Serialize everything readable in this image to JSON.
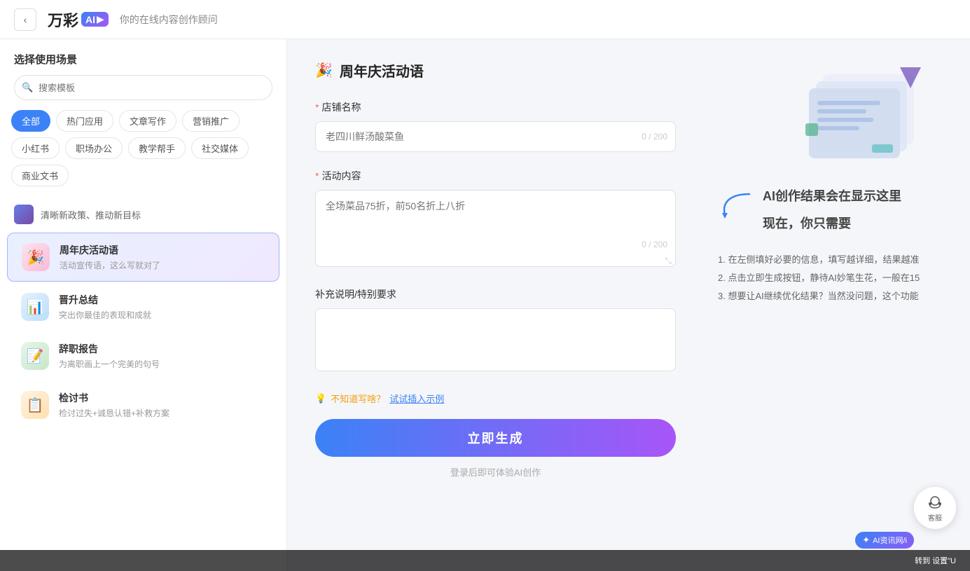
{
  "header": {
    "back_label": "‹",
    "logo_text": "万彩",
    "logo_ai": "AI",
    "subtitle": "你的在线内容创作顾问"
  },
  "sidebar": {
    "section_title": "选择使用场景",
    "search_placeholder": "搜索模板",
    "categories": [
      {
        "label": "全部",
        "active": true
      },
      {
        "label": "热门应用",
        "active": false
      },
      {
        "label": "文章写作",
        "active": false
      },
      {
        "label": "营销推广",
        "active": false
      },
      {
        "label": "小红书",
        "active": false
      },
      {
        "label": "职场办公",
        "active": false
      },
      {
        "label": "教学帮手",
        "active": false
      },
      {
        "label": "社交媒体",
        "active": false
      },
      {
        "label": "商业文书",
        "active": false
      }
    ],
    "special_item": {
      "text": "清晰新政策、推动新目标"
    },
    "items": [
      {
        "id": "anniversary",
        "title": "周年庆活动语",
        "desc": "活动宣传语，这么写就对了",
        "icon": "🎉",
        "icon_class": "item-icon-party",
        "selected": true
      },
      {
        "id": "promotion",
        "title": "晋升总结",
        "desc": "突出你最佳的表现和成就",
        "icon": "📊",
        "icon_class": "item-icon-chart",
        "selected": false
      },
      {
        "id": "resign",
        "title": "辞职报告",
        "desc": "为离职画上一个完美的句号",
        "icon": "📝",
        "icon_class": "item-icon-resign",
        "selected": false
      },
      {
        "id": "review",
        "title": "检讨书",
        "desc": "检讨过失+诚恳认错+补救方案",
        "icon": "📋",
        "icon_class": "item-icon-review",
        "selected": false
      }
    ]
  },
  "form": {
    "title": "周年庆活动语",
    "title_icon": "🎉",
    "fields": [
      {
        "id": "shop_name",
        "label": "店铺名称",
        "required": true,
        "placeholder": "老四川鲜汤酸菜鱼",
        "type": "input",
        "count": "0 / 200"
      },
      {
        "id": "activity_content",
        "label": "活动内容",
        "required": true,
        "placeholder": "全场菜品75折，前50名折上八折",
        "type": "textarea",
        "count": "0 / 200"
      },
      {
        "id": "supplement",
        "label": "补充说明/特别要求",
        "required": false,
        "placeholder": "",
        "type": "textarea_plain"
      }
    ],
    "hint_icon": "💡",
    "hint_text": "不知道写啥？试试插入示例",
    "generate_label": "立即生成",
    "login_hint": "登录后即可体验AI创作"
  },
  "right_panel": {
    "ai_hint_line1": "AI创作结果会在显示这里",
    "ai_hint_line2": "现在，你只需要",
    "steps": [
      "1. 在左侧填好必要的信息，填写越详细，结果越准",
      "2. 点击立即生成按钮，静待AI妙笔生花，一般在15",
      "3. 想要让AI继续优化结果？当然没问题，这个功能"
    ]
  },
  "customer_service": {
    "label": "客服"
  },
  "bottom_bar": {
    "text": "转到 设置\"U",
    "badge": "AI资讯网/i"
  }
}
